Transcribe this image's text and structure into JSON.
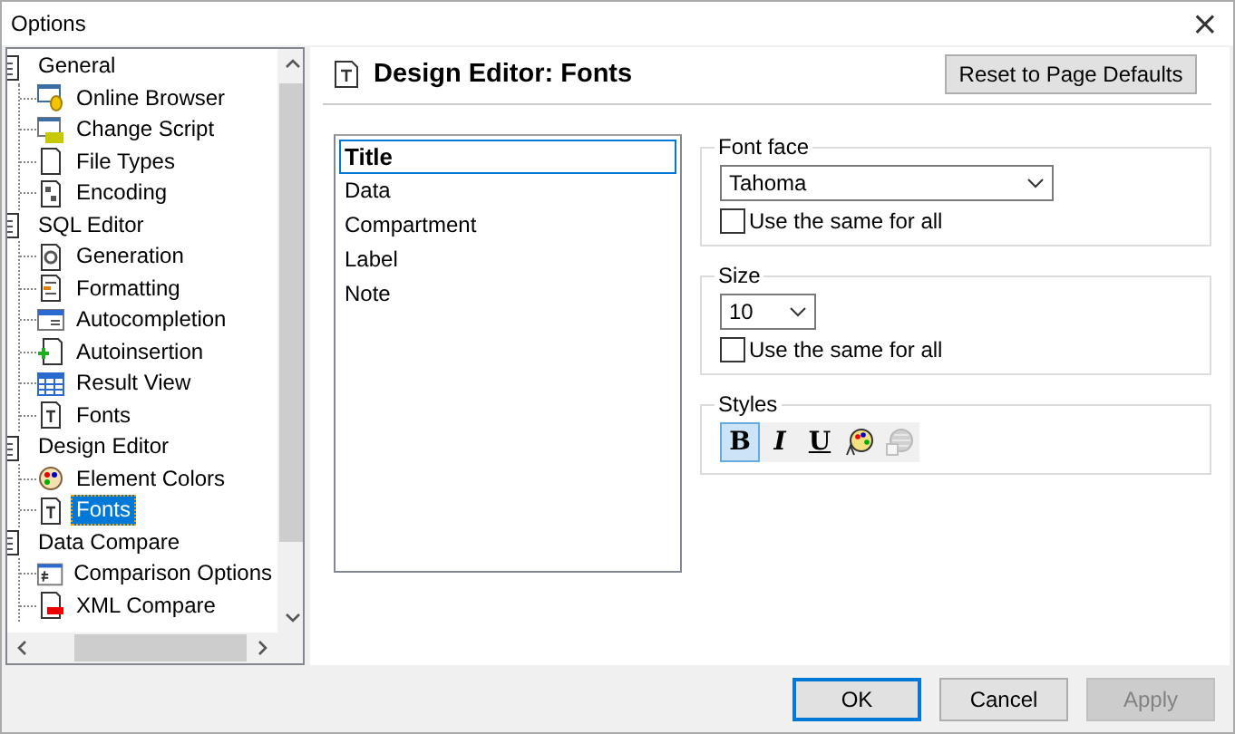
{
  "window": {
    "title": "Options",
    "close": "×"
  },
  "tree": [
    {
      "label": "General",
      "selected": false,
      "children": [
        {
          "label": "Online Browser",
          "selected": false
        },
        {
          "label": "Change Script",
          "selected": false
        },
        {
          "label": "File Types",
          "selected": false
        },
        {
          "label": "Encoding",
          "selected": false
        }
      ]
    },
    {
      "label": "SQL Editor",
      "selected": false,
      "children": [
        {
          "label": "Generation",
          "selected": false
        },
        {
          "label": "Formatting",
          "selected": false
        },
        {
          "label": "Autocompletion",
          "selected": false
        },
        {
          "label": "Autoinsertion",
          "selected": false
        },
        {
          "label": "Result View",
          "selected": false
        },
        {
          "label": "Fonts",
          "selected": false
        }
      ]
    },
    {
      "label": "Design Editor",
      "selected": false,
      "children": [
        {
          "label": "Element Colors",
          "selected": false
        },
        {
          "label": "Fonts",
          "selected": true
        }
      ]
    },
    {
      "label": "Data Compare",
      "selected": false,
      "children": [
        {
          "label": "Comparison Options",
          "selected": false
        },
        {
          "label": "XML Compare",
          "selected": false
        }
      ]
    }
  ],
  "page": {
    "title": "Design Editor: Fonts",
    "reset_button": "Reset to Page Defaults"
  },
  "elements": [
    {
      "label": "Title",
      "selected": true
    },
    {
      "label": "Data",
      "selected": false
    },
    {
      "label": "Compartment",
      "selected": false
    },
    {
      "label": "Label",
      "selected": false
    },
    {
      "label": "Note",
      "selected": false
    }
  ],
  "font_face": {
    "label": "Font face",
    "value": "Tahoma",
    "same_for_all": {
      "label": "Use the same for all",
      "checked": false
    }
  },
  "size": {
    "label": "Size",
    "value": "10",
    "same_for_all": {
      "label": "Use the same for all",
      "checked": false
    }
  },
  "styles": {
    "label": "Styles",
    "tools": [
      {
        "kind": "text",
        "label": "B",
        "selected": true,
        "disabled": false
      },
      {
        "kind": "text",
        "label": "I",
        "selected": false,
        "disabled": false
      },
      {
        "kind": "text",
        "label": "U",
        "selected": false,
        "disabled": false
      },
      {
        "kind": "palette",
        "selected": false,
        "disabled": false
      },
      {
        "kind": "hatch",
        "selected": false,
        "disabled": true
      }
    ]
  },
  "buttons": [
    {
      "label": "OK",
      "default": true,
      "disabled": false
    },
    {
      "label": "Cancel",
      "default": false,
      "disabled": false
    },
    {
      "label": "Apply",
      "default": false,
      "disabled": true
    }
  ]
}
